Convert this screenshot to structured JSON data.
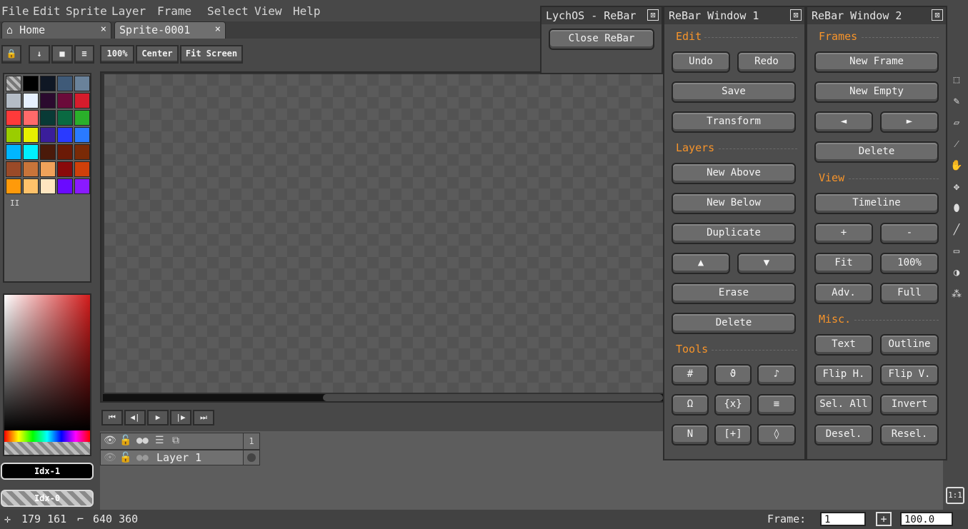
{
  "menu": [
    "File",
    "Edit",
    "Sprite",
    "Layer",
    "Frame",
    "Select",
    "View",
    "Help"
  ],
  "tabs": [
    {
      "label": "Home",
      "close": "×"
    },
    {
      "label": "Sprite-0001",
      "close": "×"
    }
  ],
  "toolbar": {
    "zoom_label": "100%",
    "center_label": "Center",
    "fit_label": "Fit Screen"
  },
  "palette_colors": [
    "#bfbfbf",
    "#000000",
    "#0f1724",
    "#3f5a78",
    "#6a829a",
    "#b4bcc6",
    "#e6f0ff",
    "#2b0a2e",
    "#6b0b3a",
    "#d61c2c",
    "#ff3a3a",
    "#ff6a6a",
    "#093a36",
    "#0a6a42",
    "#2ab02a",
    "#9acd00",
    "#e6f000",
    "#3a1e9a",
    "#2a3aff",
    "#2a7aff",
    "#00b6ff",
    "#00f0ff",
    "#4a1a0a",
    "#6b1a06",
    "#7a2a06",
    "#9a4a28",
    "#c8743a",
    "#f0a25a",
    "#8a0a0a",
    "#d0400a",
    "#ff9a0a",
    "#ffc26a",
    "#ffe6c0",
    "#6a0aff",
    "#8a1aff"
  ],
  "palette_marker": "II",
  "indexes": {
    "fg": "Idx-1",
    "bg": "Idx-0"
  },
  "timeline": {
    "controls": [
      "⏮",
      "◀|",
      "▶",
      "|▶",
      "⏭"
    ],
    "frame_number": "1",
    "layer_name": "Layer 1"
  },
  "status": {
    "cursor_pos": "179 161",
    "canvas_size": "640 360",
    "frame_label": "Frame:",
    "frame_value": "1",
    "plus": "+",
    "zoom_value": "100.0",
    "one_to_one": "1:1"
  },
  "lychos_window": {
    "title": "LychOS - ReBar",
    "close_label": "Close ReBar"
  },
  "rebar1": {
    "title": "ReBar Window 1",
    "sections": {
      "edit": "Edit",
      "layers": "Layers",
      "tools": "Tools"
    },
    "edit": {
      "undo": "Undo",
      "redo": "Redo",
      "save": "Save",
      "transform": "Transform"
    },
    "layers": {
      "new_above": "New Above",
      "new_below": "New Below",
      "duplicate": "Duplicate",
      "up": "▲",
      "down": "▼",
      "erase": "Erase",
      "delete": "Delete"
    },
    "tools": [
      "#",
      "ϑ",
      "♪",
      "Ω",
      "{x}",
      "≡",
      "N",
      "[+]",
      "◊"
    ]
  },
  "rebar2": {
    "title": "ReBar Window 2",
    "sections": {
      "frames": "Frames",
      "view": "View",
      "misc": "Misc."
    },
    "frames": {
      "new_frame": "New Frame",
      "new_empty": "New Empty",
      "prev": "◄",
      "next": "►",
      "delete": "Delete"
    },
    "view": {
      "timeline": "Timeline",
      "zoom_in": "+",
      "zoom_out": "-",
      "fit": "Fit",
      "hundred": "100%",
      "adv": "Adv.",
      "full": "Full"
    },
    "misc": {
      "text": "Text",
      "outline": "Outline",
      "flip_h": "Flip H.",
      "flip_v": "Flip V.",
      "sel_all": "Sel. All",
      "invert": "Invert",
      "desel": "Desel.",
      "resel": "Resel."
    }
  }
}
